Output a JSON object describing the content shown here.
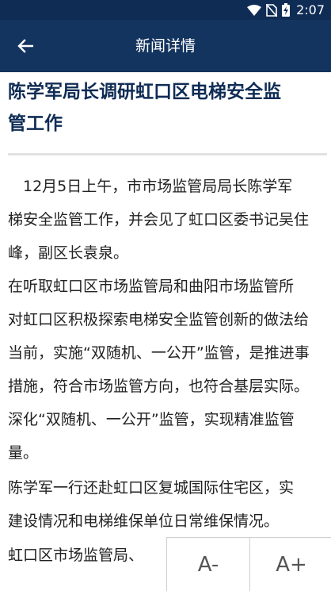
{
  "status_bar": {
    "time": "2:07",
    "icons": [
      "wifi-icon",
      "no-sim-icon",
      "battery-icon"
    ]
  },
  "app_bar": {
    "back_icon": "arrow-left-icon",
    "title": "新闻详情"
  },
  "article": {
    "title": "陈学军局长调研虹口区电梯安全监\n管工作",
    "body_lines": [
      "　12月5日上午，市市场监管局局长陈学军",
      "梯安全监管工作，并会见了虹口区委书记吴住",
      "峰，副区长袁泉。",
      " 在听取虹口区市场监管局和曲阳市场监管所",
      "对虹口区积极探索电梯安全监管创新的做法给",
      "当前，实施“双随机、一公开”监管，是推进事",
      "措施，符合市场监管方向，也符合基层实际。",
      "深化“双随机、一公开”监管，实现精准监管",
      "量。",
      " 陈学军一行还赴虹口区复城国际住宅区，实",
      "建设情况和电梯维保单位日常维保情况。",
      " 虹口区市场监管局、"
    ]
  },
  "font_controls": {
    "decrease_label": "A-",
    "increase_label": "A+"
  },
  "colors": {
    "status_bar": "#0f2c55",
    "app_bar": "#13345f",
    "title_text": "#0f2c55"
  }
}
